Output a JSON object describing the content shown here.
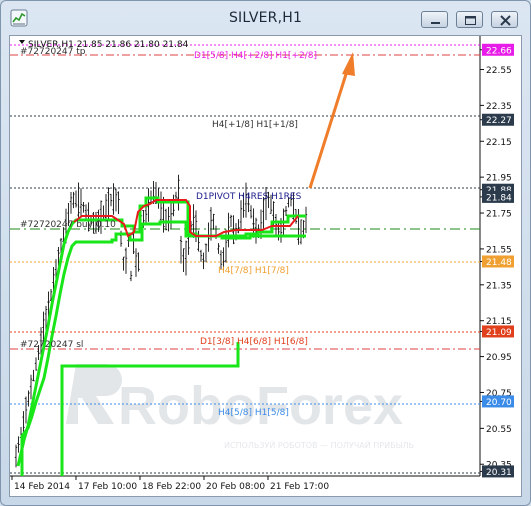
{
  "window": {
    "title": "SILVER,H1"
  },
  "chart": {
    "header": "SILVER,H1  21.85 21.86 21.80 21.84",
    "colors": {
      "bull": "#111111",
      "green": "#19e619",
      "red": "#e81c1c",
      "magenta": "#e81ce8",
      "orange": "#f07d2a",
      "blue": "#3b3b9c"
    },
    "price_labels": [
      {
        "text": "22.66",
        "bg": "#e81ce8"
      },
      {
        "text": "22.55",
        "bg": ""
      },
      {
        "text": "22.35",
        "bg": ""
      },
      {
        "text": "22.27",
        "bg": "#2b3b4b"
      },
      {
        "text": "22.15",
        "bg": ""
      },
      {
        "text": "21.95",
        "bg": ""
      },
      {
        "text": "21.88",
        "bg": "#2b3b4b"
      },
      {
        "text": "21.84",
        "bg": "#2b3b4b"
      },
      {
        "text": "21.75",
        "bg": ""
      },
      {
        "text": "21.55",
        "bg": ""
      },
      {
        "text": "21.48",
        "bg": "#f0a030"
      },
      {
        "text": "21.35",
        "bg": ""
      },
      {
        "text": "21.15",
        "bg": ""
      },
      {
        "text": "21.09",
        "bg": "#e0401c"
      },
      {
        "text": "20.95",
        "bg": ""
      },
      {
        "text": "20.75",
        "bg": ""
      },
      {
        "text": "20.70",
        "bg": "#3b8ce8"
      },
      {
        "text": "20.55",
        "bg": ""
      },
      {
        "text": "20.35",
        "bg": ""
      },
      {
        "text": "20.31",
        "bg": "#2b3b4b"
      }
    ],
    "level_labels": [
      {
        "text": "D1[5/8] H4[+2/8] H1[+2/8]",
        "color": "#e81ce8"
      },
      {
        "text": "H4[+1/8] H1[+1/8]",
        "color": "#333333"
      },
      {
        "text": "D1PIVOT H4RES H1RES",
        "color": "#1c1c8c"
      },
      {
        "text": "H4[7/8] H1[7/8]",
        "color": "#f0a030"
      },
      {
        "text": "D1[3/8] H4[6/8] H1[6/8]",
        "color": "#e0401c"
      },
      {
        "text": "H4[5/8] H1[5/8]",
        "color": "#3b8ce8"
      }
    ],
    "order_labels": [
      {
        "text": "#72720247 tp"
      },
      {
        "text": "#72720247 buy 0.10"
      },
      {
        "text": "#72720247 sl"
      }
    ],
    "time_labels": [
      "14 Feb 2014",
      "17 Feb 10:00",
      "18 Feb 22:00",
      "20 Feb 08:00",
      "21 Feb 17:00"
    ],
    "watermark": {
      "brand": "RoboForex",
      "tagline": "ИСПОЛЬЗУЙ РОБОТОВ — ПОЛУЧАЙ ПРИБЫЛЬ"
    }
  }
}
